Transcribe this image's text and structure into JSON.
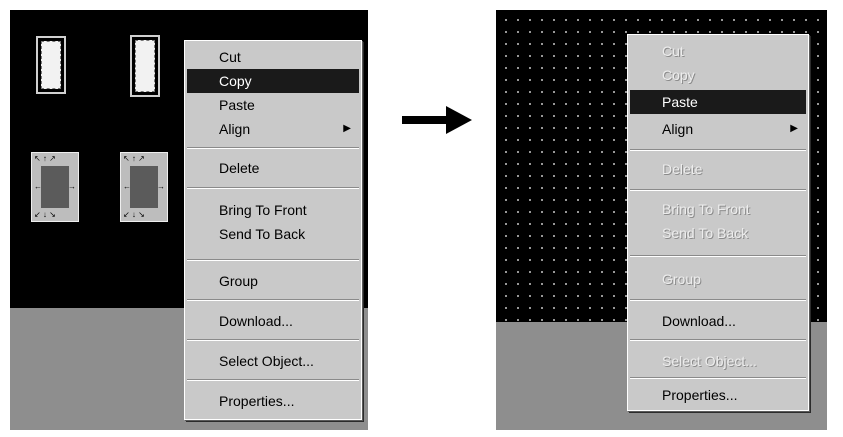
{
  "left_menu": {
    "items": [
      {
        "label": "Cut",
        "state": "normal"
      },
      {
        "label": "Copy",
        "state": "highlighted"
      },
      {
        "label": "Paste",
        "state": "normal"
      },
      {
        "label": "Align",
        "state": "normal",
        "submenu": true
      },
      {
        "label": "Delete",
        "state": "normal"
      },
      {
        "label": "Bring To Front",
        "state": "normal"
      },
      {
        "label": "Send To Back",
        "state": "normal"
      },
      {
        "label": "Group",
        "state": "normal"
      },
      {
        "label": "Download...",
        "state": "normal"
      },
      {
        "label": "Select Object...",
        "state": "normal"
      },
      {
        "label": "Properties...",
        "state": "normal"
      }
    ]
  },
  "right_menu": {
    "items": [
      {
        "label": "Cut",
        "state": "disabled"
      },
      {
        "label": "Copy",
        "state": "disabled"
      },
      {
        "label": "Paste",
        "state": "highlighted"
      },
      {
        "label": "Align",
        "state": "normal",
        "submenu": true
      },
      {
        "label": "Delete",
        "state": "disabled"
      },
      {
        "label": "Bring To Front",
        "state": "disabled"
      },
      {
        "label": "Send To Back",
        "state": "disabled"
      },
      {
        "label": "Group",
        "state": "disabled"
      },
      {
        "label": "Download...",
        "state": "normal"
      },
      {
        "label": "Select Object...",
        "state": "disabled"
      },
      {
        "label": "Properties...",
        "state": "normal"
      }
    ]
  },
  "icons": {
    "submenu": "submenu-arrow-icon",
    "transition": "right-arrow-icon"
  },
  "colors": {
    "canvas": "#000000",
    "canvas_bottom": "#8e8e8e",
    "menu_bg": "#c9c9c9",
    "highlight": "#1a1a1a"
  }
}
